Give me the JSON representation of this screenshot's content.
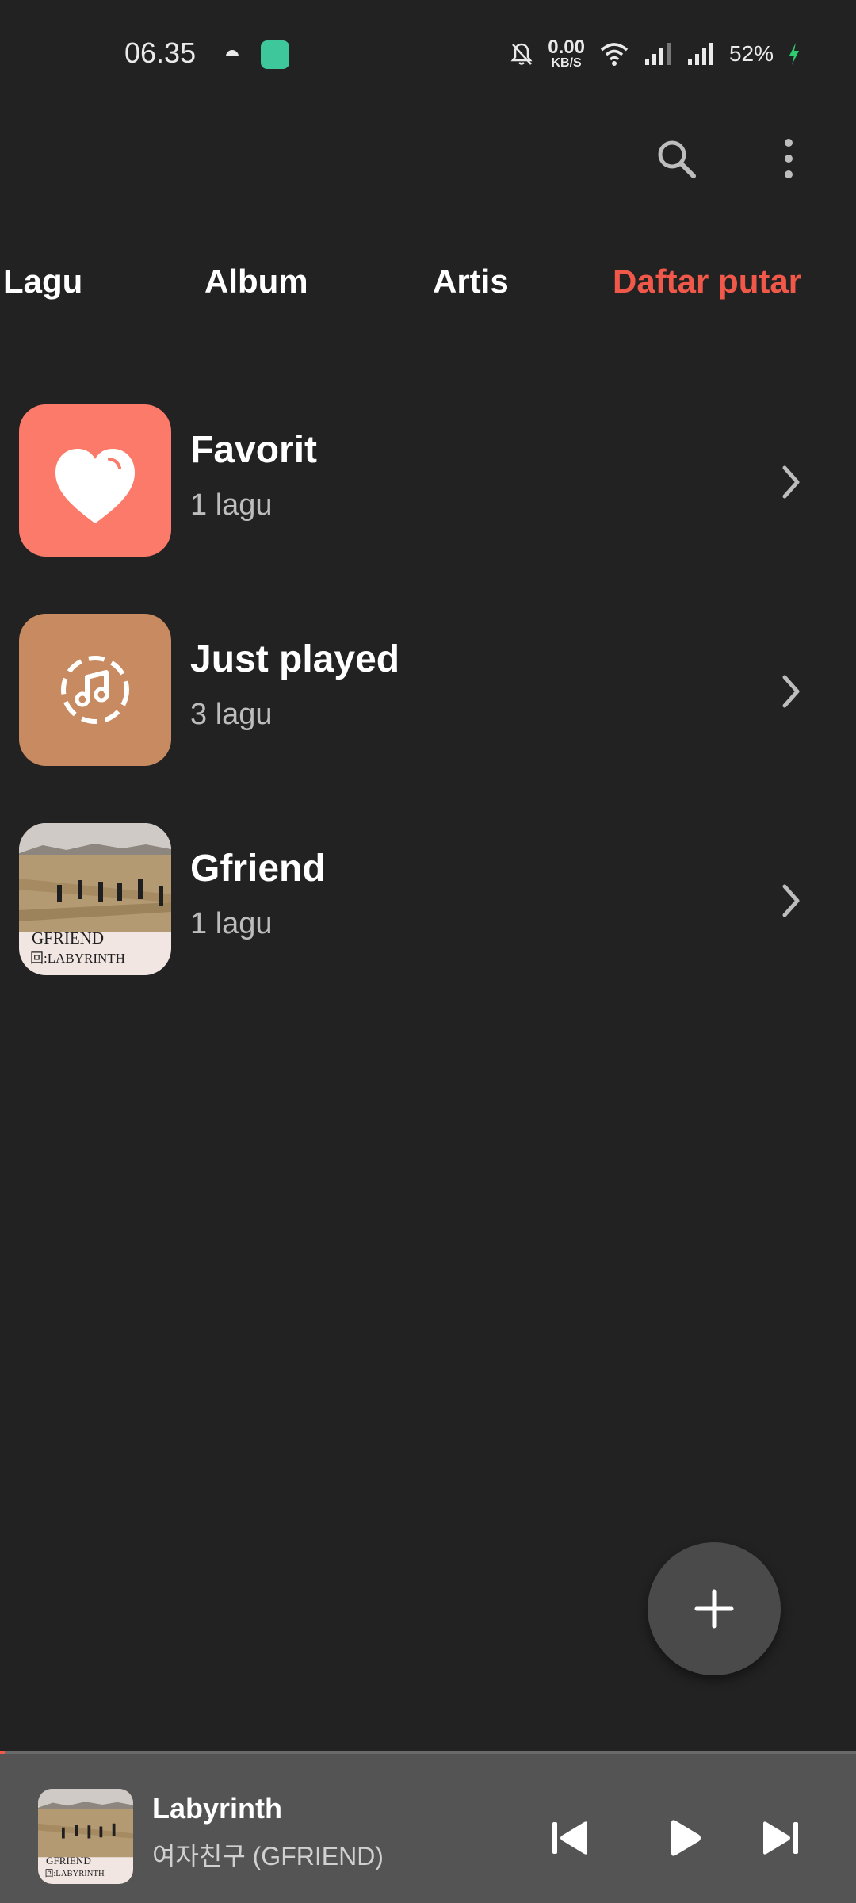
{
  "status_bar": {
    "time": "06.35",
    "net_speed_value": "0.00",
    "net_speed_unit": "KB/S",
    "battery": "52%"
  },
  "tabs": [
    {
      "label": "Lagu",
      "active": false
    },
    {
      "label": "Album",
      "active": false
    },
    {
      "label": "Artis",
      "active": false
    },
    {
      "label": "Daftar putar",
      "active": true
    }
  ],
  "playlists": [
    {
      "title": "Favorit",
      "count": "1 lagu",
      "icon": "heart-icon"
    },
    {
      "title": "Just played",
      "count": "3 lagu",
      "icon": "recent-music-icon"
    },
    {
      "title": "Gfriend",
      "count": "1 lagu",
      "icon": "album-art"
    }
  ],
  "album_art_text": {
    "line1": "GFRIEND",
    "line2": "回:LABYRINTH"
  },
  "now_playing": {
    "title": "Labyrinth",
    "artist": "여자친구 (GFRIEND)",
    "progress": 0.005
  },
  "colors": {
    "accent": "#f0584a",
    "background": "#222222",
    "favorite_tile": "#fb7a6a",
    "just_played_tile": "#c88a60",
    "mini_player": "#545454"
  }
}
